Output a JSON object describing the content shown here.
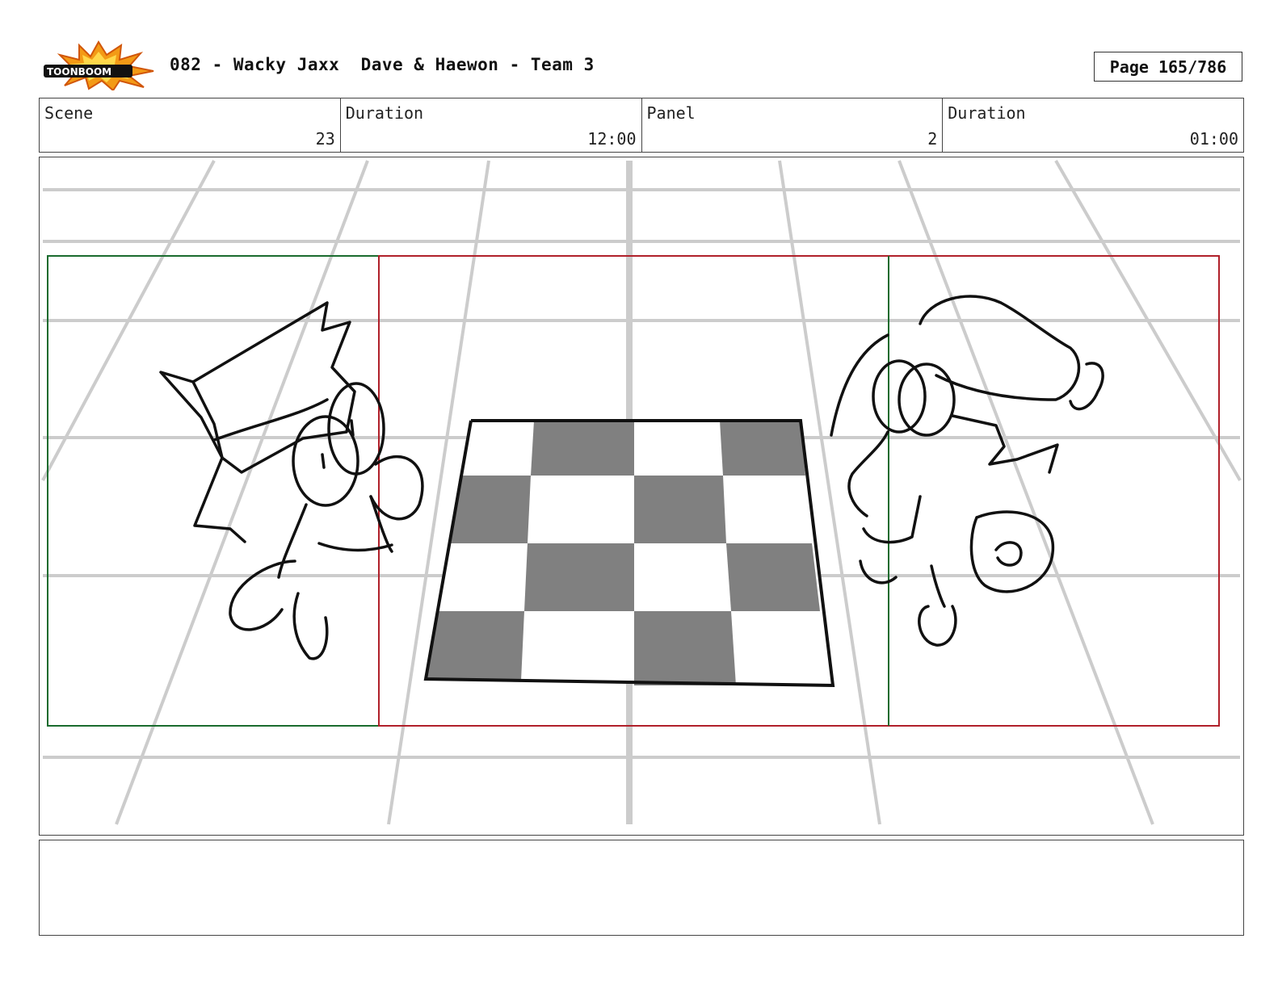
{
  "header": {
    "logo_icon": "toonboom-logo-icon",
    "logo_text": "TOONBOOM",
    "title": "082 - Wacky Jaxx  Dave & Haewon - Team 3",
    "page": "Page 165/786"
  },
  "info": {
    "scene_label": "Scene",
    "scene_value": "23",
    "duration_label": "Duration",
    "duration_value": "12:00",
    "panel_label": "Panel",
    "panel_value": "2",
    "panel_duration_label": "Duration",
    "panel_duration_value": "01:00"
  },
  "colors": {
    "safe_frame_green": "#1a6b2e",
    "camera_frame_red": "#b0202a",
    "perspective_grid": "#cccccc",
    "checker_dark": "#808080"
  },
  "notes": {
    "text": ""
  }
}
